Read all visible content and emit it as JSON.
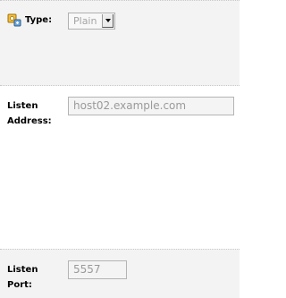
{
  "type_field": {
    "label": "Type:",
    "selected_value": "Plain",
    "icon": "settings-key-icon"
  },
  "listen_address": {
    "label": "Listen Address:",
    "value": "host02.example.com"
  },
  "listen_port": {
    "label": "Listen Port:",
    "value": "5557"
  },
  "colors": {
    "row_alt_bg": "#f3f3f3",
    "disabled_text": "#9a9a9a",
    "icon_accent": "#e0a020"
  }
}
